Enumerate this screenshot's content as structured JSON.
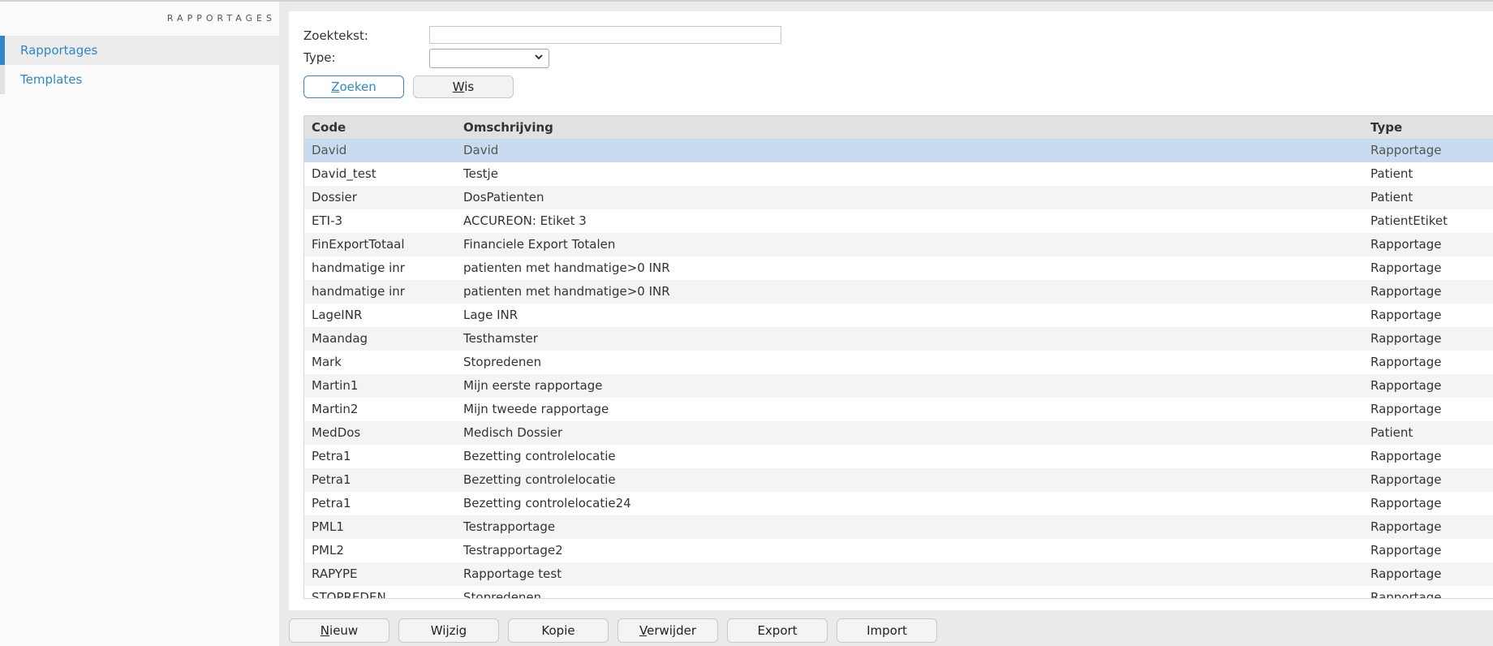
{
  "sidebar": {
    "title": "RAPPORTAGES",
    "items": [
      {
        "label": "Rapportages",
        "active": true
      },
      {
        "label": "Templates",
        "active": false
      }
    ]
  },
  "search": {
    "zoektekst_label": "Zoektekst:",
    "zoektekst_value": "",
    "type_label": "Type:",
    "type_value": ""
  },
  "buttons": {
    "zoeken": {
      "first": "Z",
      "rest": "oeken"
    },
    "wis": {
      "first": "W",
      "rest": "is"
    }
  },
  "table": {
    "headers": [
      "Code",
      "Omschrijving",
      "Type"
    ],
    "rows": [
      {
        "code": "David",
        "omschrijving": "David",
        "type": "Rapportage",
        "selected": true
      },
      {
        "code": "David_test",
        "omschrijving": "Testje",
        "type": "Patient"
      },
      {
        "code": "Dossier",
        "omschrijving": "DosPatienten",
        "type": "Patient"
      },
      {
        "code": "ETI-3",
        "omschrijving": "ACCUREON: Etiket 3",
        "type": "PatientEtiket"
      },
      {
        "code": "FinExportTotaal",
        "omschrijving": "Financiele Export Totalen",
        "type": "Rapportage"
      },
      {
        "code": "handmatige inr",
        "omschrijving": "patienten met handmatige>0 INR",
        "type": "Rapportage"
      },
      {
        "code": "handmatige inr",
        "omschrijving": "patienten met handmatige>0 INR",
        "type": "Rapportage"
      },
      {
        "code": "LageINR",
        "omschrijving": "Lage INR",
        "type": "Rapportage"
      },
      {
        "code": "Maandag",
        "omschrijving": "Testhamster",
        "type": "Rapportage"
      },
      {
        "code": "Mark",
        "omschrijving": "Stopredenen",
        "type": "Rapportage"
      },
      {
        "code": "Martin1",
        "omschrijving": "Mijn eerste rapportage",
        "type": "Rapportage"
      },
      {
        "code": "Martin2",
        "omschrijving": "Mijn tweede rapportage",
        "type": "Rapportage"
      },
      {
        "code": "MedDos",
        "omschrijving": "Medisch Dossier",
        "type": "Patient"
      },
      {
        "code": "Petra1",
        "omschrijving": "Bezetting controlelocatie",
        "type": "Rapportage"
      },
      {
        "code": "Petra1",
        "omschrijving": "Bezetting controlelocatie",
        "type": "Rapportage"
      },
      {
        "code": "Petra1",
        "omschrijving": "Bezetting controlelocatie24",
        "type": "Rapportage"
      },
      {
        "code": "PML1",
        "omschrijving": "Testrapportage",
        "type": "Rapportage"
      },
      {
        "code": "PML2",
        "omschrijving": "Testrapportage2",
        "type": "Rapportage"
      },
      {
        "code": "RAPYPE",
        "omschrijving": "Rapportage test",
        "type": "Rapportage"
      },
      {
        "code": "STOPREDEN",
        "omschrijving": "Stopredenen",
        "type": "Rapportage"
      }
    ]
  },
  "actions": [
    {
      "first": "N",
      "rest": "ieuw"
    },
    {
      "first": "",
      "rest": "Wijzig"
    },
    {
      "first": "",
      "rest": "Kopie"
    },
    {
      "first": "V",
      "rest": "erwijder"
    },
    {
      "first": "",
      "rest": "Export"
    },
    {
      "first": "",
      "rest": "Import"
    }
  ],
  "colors": {
    "accent": "#2f86c9",
    "selected_row": "#c9dcef",
    "header_bg": "#e1e1e1"
  }
}
